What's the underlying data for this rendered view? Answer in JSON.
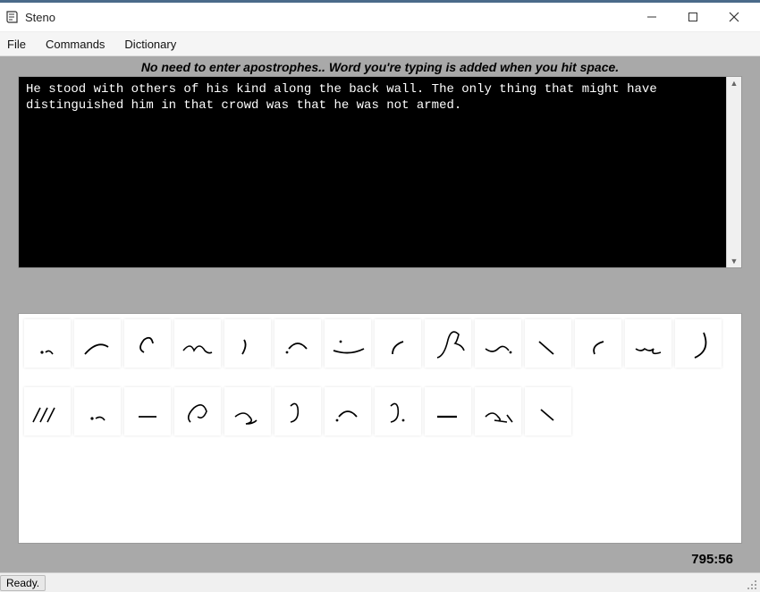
{
  "window": {
    "title": "Steno"
  },
  "menu": {
    "file": "File",
    "commands": "Commands",
    "dictionary": "Dictionary"
  },
  "hint": "No need to enter apostrophes.. Word you're typing is  added when you hit space.",
  "editor": {
    "text": "He stood with others of his kind along the back wall. The only thing that might have distinguished him in that crowd was that he was not armed."
  },
  "timer": "795:56",
  "status": "Ready.",
  "shorthand_glyphs_row1": [
    "g1",
    "g2",
    "g3",
    "g4",
    "g5",
    "g6",
    "g7",
    "g8",
    "g9",
    "g10",
    "g11",
    "g12",
    "g13",
    "g14"
  ],
  "shorthand_glyphs_row2": [
    "g15",
    "g16",
    "g17",
    "g18",
    "g19",
    "g20",
    "g21",
    "g22",
    "g23",
    "g24",
    "g25"
  ]
}
